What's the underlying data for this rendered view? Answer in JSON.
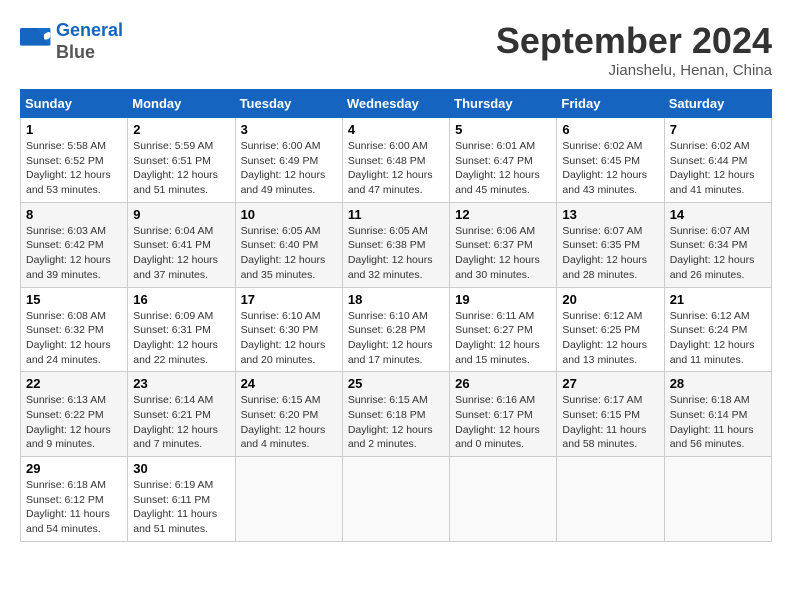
{
  "header": {
    "logo_line1": "General",
    "logo_line2": "Blue",
    "month": "September 2024",
    "location": "Jianshelu, Henan, China"
  },
  "days_of_week": [
    "Sunday",
    "Monday",
    "Tuesday",
    "Wednesday",
    "Thursday",
    "Friday",
    "Saturday"
  ],
  "weeks": [
    [
      {
        "day": "1",
        "sunrise": "5:58 AM",
        "sunset": "6:52 PM",
        "daylight": "12 hours and 53 minutes."
      },
      {
        "day": "2",
        "sunrise": "5:59 AM",
        "sunset": "6:51 PM",
        "daylight": "12 hours and 51 minutes."
      },
      {
        "day": "3",
        "sunrise": "6:00 AM",
        "sunset": "6:49 PM",
        "daylight": "12 hours and 49 minutes."
      },
      {
        "day": "4",
        "sunrise": "6:00 AM",
        "sunset": "6:48 PM",
        "daylight": "12 hours and 47 minutes."
      },
      {
        "day": "5",
        "sunrise": "6:01 AM",
        "sunset": "6:47 PM",
        "daylight": "12 hours and 45 minutes."
      },
      {
        "day": "6",
        "sunrise": "6:02 AM",
        "sunset": "6:45 PM",
        "daylight": "12 hours and 43 minutes."
      },
      {
        "day": "7",
        "sunrise": "6:02 AM",
        "sunset": "6:44 PM",
        "daylight": "12 hours and 41 minutes."
      }
    ],
    [
      {
        "day": "8",
        "sunrise": "6:03 AM",
        "sunset": "6:42 PM",
        "daylight": "12 hours and 39 minutes."
      },
      {
        "day": "9",
        "sunrise": "6:04 AM",
        "sunset": "6:41 PM",
        "daylight": "12 hours and 37 minutes."
      },
      {
        "day": "10",
        "sunrise": "6:05 AM",
        "sunset": "6:40 PM",
        "daylight": "12 hours and 35 minutes."
      },
      {
        "day": "11",
        "sunrise": "6:05 AM",
        "sunset": "6:38 PM",
        "daylight": "12 hours and 32 minutes."
      },
      {
        "day": "12",
        "sunrise": "6:06 AM",
        "sunset": "6:37 PM",
        "daylight": "12 hours and 30 minutes."
      },
      {
        "day": "13",
        "sunrise": "6:07 AM",
        "sunset": "6:35 PM",
        "daylight": "12 hours and 28 minutes."
      },
      {
        "day": "14",
        "sunrise": "6:07 AM",
        "sunset": "6:34 PM",
        "daylight": "12 hours and 26 minutes."
      }
    ],
    [
      {
        "day": "15",
        "sunrise": "6:08 AM",
        "sunset": "6:32 PM",
        "daylight": "12 hours and 24 minutes."
      },
      {
        "day": "16",
        "sunrise": "6:09 AM",
        "sunset": "6:31 PM",
        "daylight": "12 hours and 22 minutes."
      },
      {
        "day": "17",
        "sunrise": "6:10 AM",
        "sunset": "6:30 PM",
        "daylight": "12 hours and 20 minutes."
      },
      {
        "day": "18",
        "sunrise": "6:10 AM",
        "sunset": "6:28 PM",
        "daylight": "12 hours and 17 minutes."
      },
      {
        "day": "19",
        "sunrise": "6:11 AM",
        "sunset": "6:27 PM",
        "daylight": "12 hours and 15 minutes."
      },
      {
        "day": "20",
        "sunrise": "6:12 AM",
        "sunset": "6:25 PM",
        "daylight": "12 hours and 13 minutes."
      },
      {
        "day": "21",
        "sunrise": "6:12 AM",
        "sunset": "6:24 PM",
        "daylight": "12 hours and 11 minutes."
      }
    ],
    [
      {
        "day": "22",
        "sunrise": "6:13 AM",
        "sunset": "6:22 PM",
        "daylight": "12 hours and 9 minutes."
      },
      {
        "day": "23",
        "sunrise": "6:14 AM",
        "sunset": "6:21 PM",
        "daylight": "12 hours and 7 minutes."
      },
      {
        "day": "24",
        "sunrise": "6:15 AM",
        "sunset": "6:20 PM",
        "daylight": "12 hours and 4 minutes."
      },
      {
        "day": "25",
        "sunrise": "6:15 AM",
        "sunset": "6:18 PM",
        "daylight": "12 hours and 2 minutes."
      },
      {
        "day": "26",
        "sunrise": "6:16 AM",
        "sunset": "6:17 PM",
        "daylight": "12 hours and 0 minutes."
      },
      {
        "day": "27",
        "sunrise": "6:17 AM",
        "sunset": "6:15 PM",
        "daylight": "11 hours and 58 minutes."
      },
      {
        "day": "28",
        "sunrise": "6:18 AM",
        "sunset": "6:14 PM",
        "daylight": "11 hours and 56 minutes."
      }
    ],
    [
      {
        "day": "29",
        "sunrise": "6:18 AM",
        "sunset": "6:12 PM",
        "daylight": "11 hours and 54 minutes."
      },
      {
        "day": "30",
        "sunrise": "6:19 AM",
        "sunset": "6:11 PM",
        "daylight": "11 hours and 51 minutes."
      },
      null,
      null,
      null,
      null,
      null
    ]
  ]
}
